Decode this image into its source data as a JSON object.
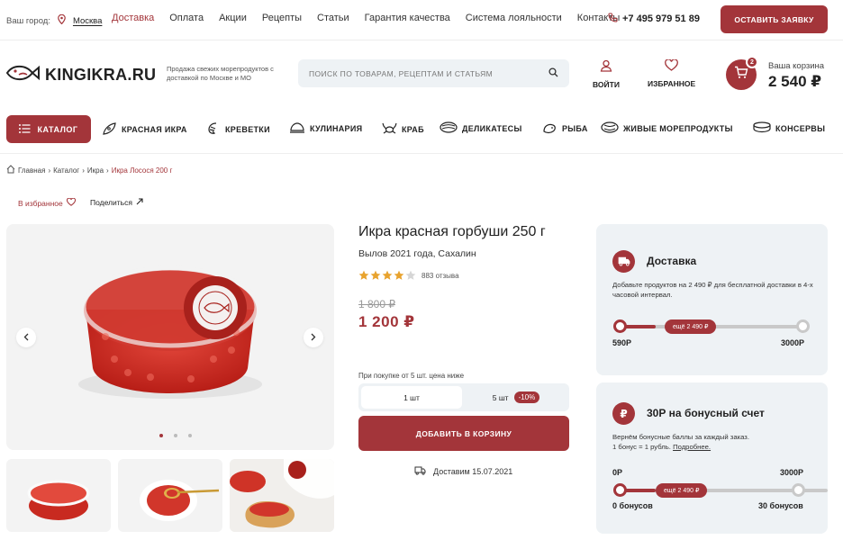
{
  "topbar": {
    "city_label": "Ваш город:",
    "city_name": "Москва",
    "nav": [
      {
        "label": "Доставка",
        "active": true
      },
      {
        "label": "Оплата",
        "active": false
      },
      {
        "label": "Акции",
        "active": false
      },
      {
        "label": "Рецепты",
        "active": false
      },
      {
        "label": "Статьи",
        "active": false
      },
      {
        "label": "Гарантия качества",
        "active": false
      },
      {
        "label": "Система лояльности",
        "active": false
      },
      {
        "label": "Контакты",
        "active": false
      }
    ],
    "phone": "+7 495 979 51 89",
    "request_button": "ОСТАВИТЬ ЗАЯВКУ"
  },
  "header": {
    "logo_text": "KINGIKRA.RU",
    "tagline": "Продажа свежих морепродуктов с доставкой по Москве и МО",
    "search_placeholder": "ПОИСК ПО ТОВАРАМ, РЕЦЕПТАМ И СТАТЬЯМ",
    "login_label": "ВОЙТИ",
    "favorites_label": "ИЗБРАННОЕ",
    "cart_count": "2",
    "cart_label": "Ваша корзина",
    "cart_total": "2 540 ₽"
  },
  "catalog": {
    "button_label": "КАТАЛОГ",
    "items": [
      {
        "label": "КРАСНАЯ ИКРА",
        "icon": "caviar-icon"
      },
      {
        "label": "КРЕВЕТКИ",
        "icon": "shrimp-icon"
      },
      {
        "label": "КУЛИНАРИЯ",
        "icon": "cooking-icon"
      },
      {
        "label": "КРАБ",
        "icon": "crab-icon"
      },
      {
        "label": "ДЕЛИКАТЕСЫ",
        "icon": "oyster-icon"
      },
      {
        "label": "РЫБА",
        "icon": "fish-icon"
      },
      {
        "label": "ЖИВЫЕ МОРЕПРОДУКТЫ",
        "icon": "mussel-icon"
      },
      {
        "label": "КОНСЕРВЫ",
        "icon": "can-icon"
      }
    ]
  },
  "breadcrumb": {
    "items": [
      "Главная",
      "Каталог",
      "Икра"
    ],
    "current": "Икра Лосося 200 г"
  },
  "actions": {
    "favorite": "В избранное",
    "share": "Поделиться"
  },
  "product": {
    "title": "Икра красная горбуши 250 г",
    "subtitle": "Вылов 2021 года, Сахалин",
    "rating": 4,
    "rating_max": 5,
    "reviews": "883 отзыва",
    "old_price": "1 800 ₽",
    "price": "1 200 ₽",
    "bulk_note": "При покупке от 5 шт. цена ниже",
    "qty_options": [
      {
        "label": "1 шт",
        "selected": true
      },
      {
        "label": "5 шт",
        "selected": false,
        "badge": "-10%"
      }
    ],
    "add_button": "ДОБАВИТЬ В КОРЗИНУ",
    "delivery_date": "Доставим 15.07.2021",
    "jar_text": "PREMIUM QUALITY • KINGIKRA.RU",
    "gallery_active_index": 0,
    "gallery_count": 3
  },
  "delivery_card": {
    "title": "Доставка",
    "text": "Добавьте продуктов на 2 490 ₽ для бесплатной доставки в 4-х часовой интервал.",
    "progress_min": "590Р",
    "progress_max": "3000Р",
    "progress_pill": "ещё 2 490 ₽",
    "progress": 0.2
  },
  "bonus_card": {
    "icon_text": "₽",
    "title": "30Р на бонусный счет",
    "text_1": "Вернём бонусные баллы за каждый заказ.",
    "text_2": "1 бонус = 1 рубль.",
    "more_link": "Подробнее.",
    "scale_left": "0Р",
    "scale_right": "3000Р",
    "bonus_left": "0 бонусов",
    "bonus_right": "30 бонусов",
    "progress_pill": "ещё 2 490 ₽"
  },
  "colors": {
    "accent": "#a3353a",
    "panel": "#eef2f5"
  }
}
